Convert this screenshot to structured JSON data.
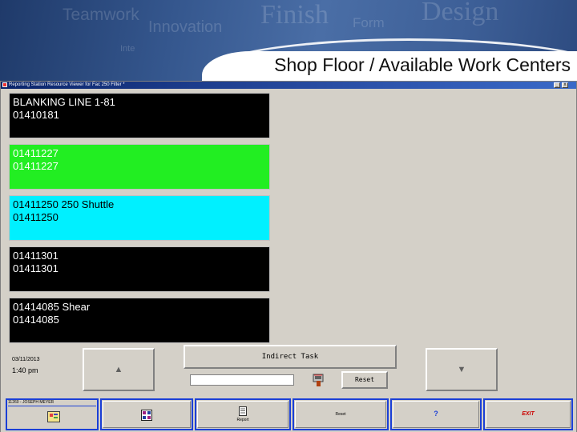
{
  "banner": {
    "watermarks": [
      "Teamwork",
      "Innovation",
      "Finish",
      "Form",
      "Design",
      "Inte"
    ],
    "title": "Shop Floor / Available Work Centers"
  },
  "window": {
    "title": "Reporting Station Resource Viewer for Fac 250 Filter *"
  },
  "work_centers": [
    {
      "line1": "BLANKING LINE 1-81",
      "line2": "01410181",
      "bg": "#000000",
      "fg": "#ffffff"
    },
    {
      "line1": "01411227",
      "line2": "01411227",
      "bg": "#22ee22",
      "fg": "#ffffff"
    },
    {
      "line1": "01411250 250 Shuttle",
      "line2": "01411250",
      "bg": "#00f0ff",
      "fg": "#000000"
    },
    {
      "line1": "01411301",
      "line2": "01411301",
      "bg": "#000000",
      "fg": "#ffffff"
    },
    {
      "line1": "01414085 Shear",
      "line2": "01414085",
      "bg": "#000000",
      "fg": "#ffffff"
    }
  ],
  "status": {
    "date": "03/11/2013",
    "time": "1:40 pm"
  },
  "controls": {
    "up_arrow": "▲",
    "down_arrow": "▼",
    "indirect_task_label": "Indirect Task",
    "task_input_value": "",
    "reset_label": "Reset"
  },
  "toolbar": {
    "user": "11260 - JOSEPH MEYER",
    "report_label": "Report",
    "reset_label": "Reset",
    "help_label": "?",
    "exit_label": "EXIT"
  },
  "colors": {
    "toolbar_border": "#1b3fd6",
    "exit_red": "#cc0000"
  }
}
